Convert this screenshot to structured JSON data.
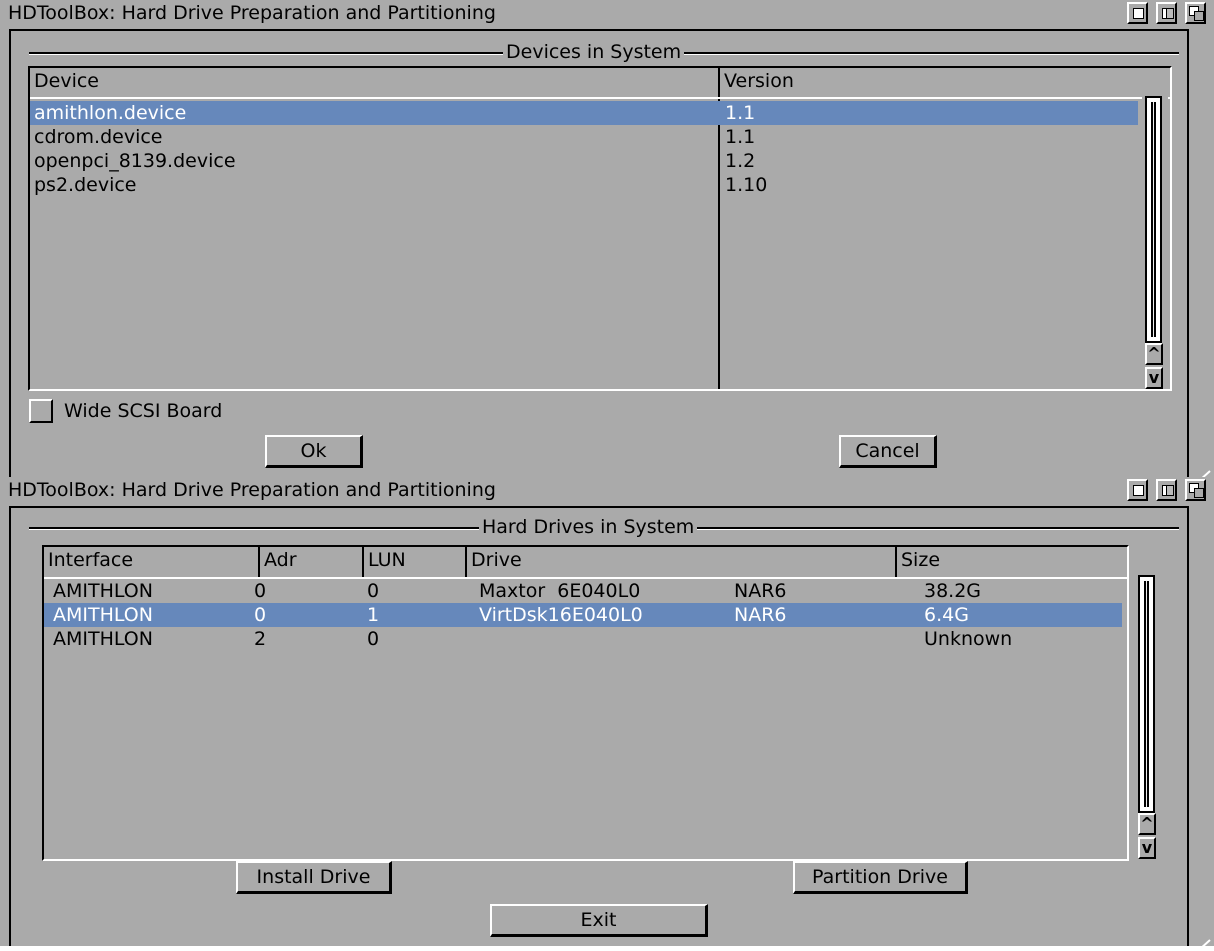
{
  "window1": {
    "title": "HDToolBox: Hard Drive Preparation and Partitioning",
    "group_title": "Devices in System",
    "columns": [
      "Device",
      "Version"
    ],
    "rows": [
      {
        "device": "amithlon.device",
        "version": "1.1",
        "selected": true
      },
      {
        "device": "cdrom.device",
        "version": "1.1",
        "selected": false
      },
      {
        "device": "openpci_8139.device",
        "version": "1.2",
        "selected": false
      },
      {
        "device": "ps2.device",
        "version": "1.10",
        "selected": false
      }
    ],
    "wide_scsi_label": "Wide SCSI Board",
    "wide_scsi_checked": false,
    "ok_label": "Ok",
    "cancel_label": "Cancel",
    "scroll_up": "^",
    "scroll_down": "v"
  },
  "window2": {
    "title": "HDToolBox: Hard Drive Preparation and Partitioning",
    "group_title": "Hard Drives in System",
    "columns": [
      "Interface",
      "Adr",
      "LUN",
      "Drive",
      "Size"
    ],
    "rows": [
      {
        "interface": "AMITHLON",
        "adr": "0",
        "lun": "0",
        "drive": "Maxtor  6E040L0",
        "rev": "NAR6",
        "size": "38.2G",
        "selected": false
      },
      {
        "interface": "AMITHLON",
        "adr": "0",
        "lun": "1",
        "drive": "VirtDsk16E040L0",
        "rev": "NAR6",
        "size": "6.4G",
        "selected": true
      },
      {
        "interface": "AMITHLON",
        "adr": "2",
        "lun": "0",
        "drive": "",
        "rev": "",
        "size": "Unknown",
        "selected": false
      }
    ],
    "install_label": "Install Drive",
    "partition_label": "Partition Drive",
    "exit_label": "Exit",
    "scroll_up": "^",
    "scroll_down": "v"
  },
  "colors": {
    "background": "#aaaaaa",
    "selection": "#6688bb"
  }
}
